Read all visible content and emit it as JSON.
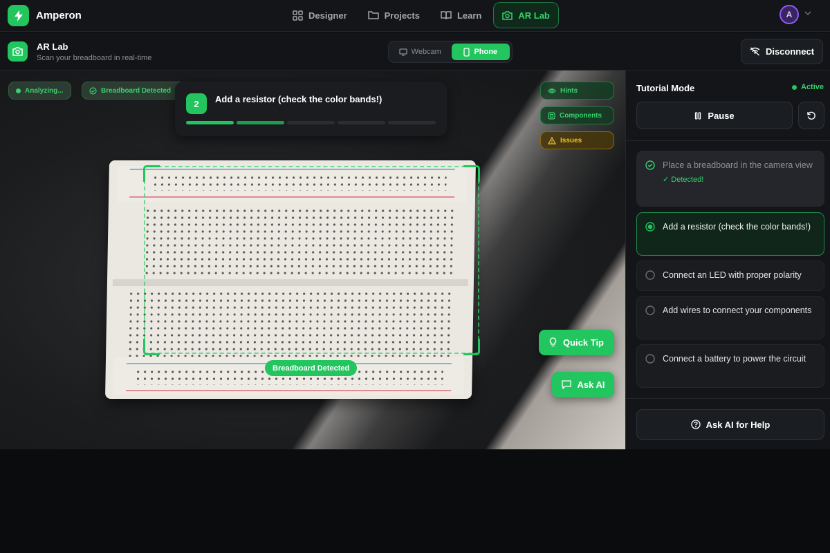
{
  "app": {
    "name": "Amperon"
  },
  "nav": {
    "tabs": [
      {
        "label": "Designer",
        "icon": "grid-icon"
      },
      {
        "label": "Projects",
        "icon": "folder-icon"
      },
      {
        "label": "Learn",
        "icon": "book-icon"
      },
      {
        "label": "AR Lab",
        "icon": "camera-icon",
        "active": true
      }
    ],
    "avatar_initial": "A"
  },
  "header": {
    "title": "AR Lab",
    "subtitle": "Scan your breadboard in real-time",
    "source_options": [
      {
        "label": "Webcam",
        "icon": "monitor-icon"
      },
      {
        "label": "Phone",
        "icon": "phone-icon",
        "selected": true
      }
    ],
    "disconnect_label": "Disconnect"
  },
  "camera": {
    "status_pills": [
      "Analyzing...",
      "Breadboard Detected"
    ],
    "detected_label": "Breadboard Detected",
    "step": {
      "number": "2",
      "text": "Add a resistor (check the color bands!)",
      "total_segments": 5,
      "completed": 1
    },
    "toggles": [
      {
        "label": "Hints",
        "icon": "eye-icon",
        "variant": "green"
      },
      {
        "label": "Components",
        "icon": "chip-icon",
        "variant": "green"
      },
      {
        "label": "Issues",
        "icon": "warning-icon",
        "variant": "yellow"
      }
    ],
    "quick_tip_label": "Quick Tip",
    "ask_ai_label": "Ask AI"
  },
  "tutorial": {
    "title": "Tutorial Mode",
    "status": "Active",
    "pause_label": "Pause",
    "steps": [
      {
        "text": "Place a breadboard in the camera view",
        "state": "done",
        "note": "✓ Detected!"
      },
      {
        "text": "Add a resistor (check the color bands!)",
        "state": "current"
      },
      {
        "text": "Connect an LED with proper polarity",
        "state": "pending"
      },
      {
        "text": "Add wires to connect your components",
        "state": "pending"
      },
      {
        "text": "Connect a battery to power the circuit",
        "state": "pending"
      }
    ],
    "ask_help_label": "Ask AI for Help"
  },
  "colors": {
    "accent": "#22c55e",
    "warning": "#f2c230",
    "background": "#0b0c0e"
  }
}
